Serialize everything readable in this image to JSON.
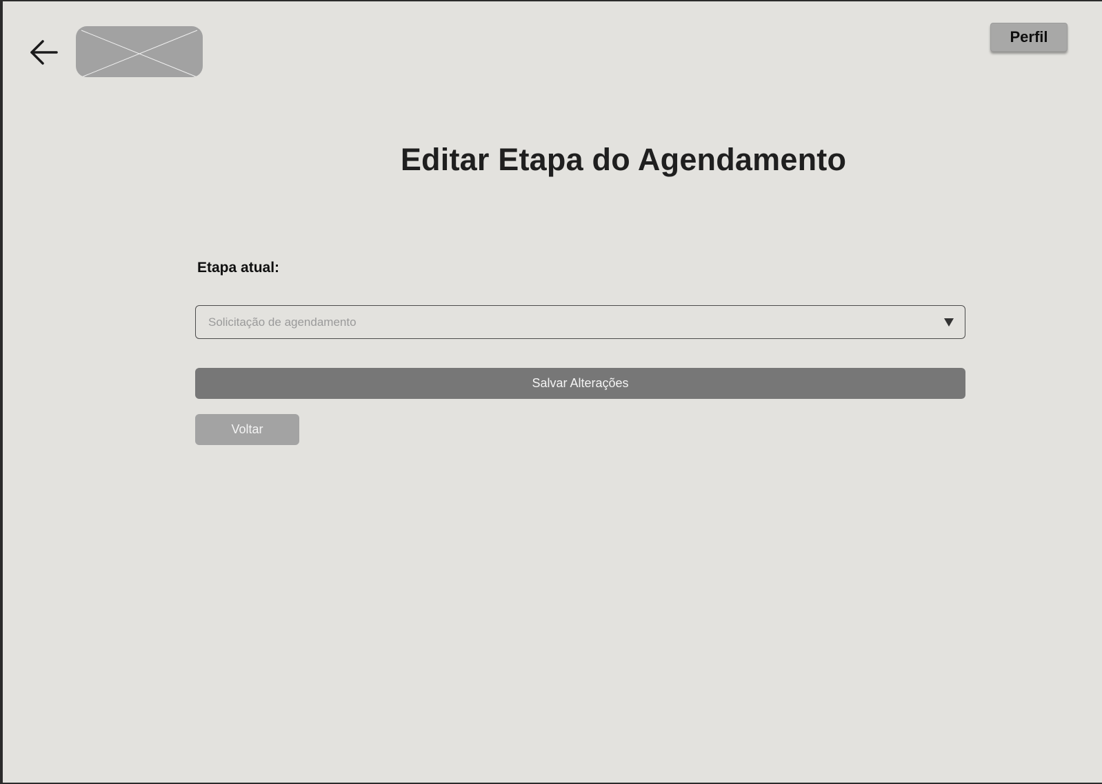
{
  "header": {
    "back_icon": "arrow-left-icon",
    "logo_icon": "image-placeholder-icon",
    "profile_label": "Perfil"
  },
  "main": {
    "title": "Editar Etapa do Agendamento",
    "stage_label": "Etapa atual:",
    "stage_select": {
      "placeholder": "Solicitação de agendamento",
      "icon": "caret-down-icon"
    },
    "save_label": "Salvar Alterações",
    "back_label": "Voltar"
  },
  "colors": {
    "background": "#e3e2de",
    "primary_button": "#777777",
    "secondary_button": "#a3a3a3",
    "profile_button": "#a8a8a7",
    "placeholder": "#a2a2a2"
  }
}
